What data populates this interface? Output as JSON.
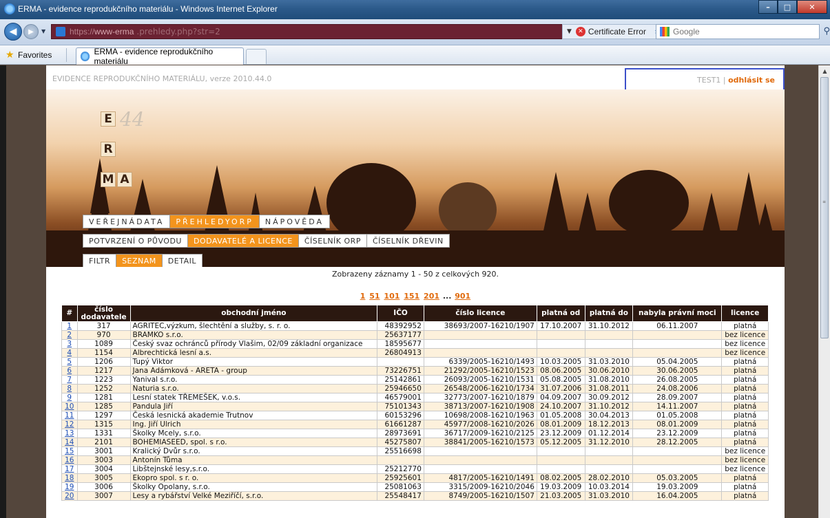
{
  "window": {
    "title": "ERMA - evidence reprodukčního materiálu - Windows Internet Explorer",
    "buttons": {
      "minimize": "–",
      "maximize": "□",
      "close": "✕"
    }
  },
  "browser": {
    "url_prefix": "https://",
    "url_host": "www-erma",
    "url_rest": ".prehledy.php?str=2",
    "cert_error": "Certificate Error",
    "search_placeholder": "Google",
    "favorites": "Favorites",
    "tab_title": "ERMA - evidence reprodukčního materiálu"
  },
  "header": {
    "app_version": "EVIDENCE REPRODUKČNÍHO MATERIÁLU, verze 2010.44.0",
    "user": "TEST1",
    "separator": "|",
    "logout": "odhlásit se"
  },
  "logo": {
    "letters": [
      "E",
      "R",
      "M",
      "A"
    ],
    "version": "44"
  },
  "menu_main": [
    {
      "label": "VEŘEJNÁDATA",
      "active": false
    },
    {
      "label": "PŘEHLEDYORP",
      "active": true
    },
    {
      "label": "NÁPOVĚDA",
      "active": false
    }
  ],
  "menu_sub": [
    {
      "label": "POTVRZENÍ O PŮVODU",
      "active": false
    },
    {
      "label": "DODAVATELÉ A LICENCE",
      "active": true
    },
    {
      "label": "ČÍSELNÍK ORP",
      "active": false
    },
    {
      "label": "ČÍSELNÍK DŘEVIN",
      "active": false
    }
  ],
  "menu_view": [
    {
      "label": "FILTR",
      "active": false
    },
    {
      "label": "SEZNAM",
      "active": true
    },
    {
      "label": "DETAIL",
      "active": false
    }
  ],
  "records_info": "Zobrazeny záznamy 1 - 50 z celkových 920.",
  "pager": {
    "pages": [
      "1",
      "51",
      "101",
      "151",
      "201"
    ],
    "ellipsis": "...",
    "last": "901"
  },
  "table": {
    "headers": [
      "#",
      "číslo dodavatele",
      "obchodní jméno",
      "IČO",
      "číslo licence",
      "platná od",
      "platná do",
      "nabyla právní moci",
      "licence"
    ],
    "rows": [
      [
        "1",
        "317",
        "AGRITEC,výzkum, šlechtění a služby, s. r. o.",
        "48392952",
        "38693/2007-16210/1907",
        "17.10.2007",
        "31.10.2012",
        "06.11.2007",
        "platná"
      ],
      [
        "2",
        "970",
        "BRAMKO s.r.o.",
        "25637177",
        "",
        "",
        "",
        "",
        "bez licence"
      ],
      [
        "3",
        "1089",
        "Český svaz ochránců přírody Vlašim, 02/09 základní organizace",
        "18595677",
        "",
        "",
        "",
        "",
        "bez licence"
      ],
      [
        "4",
        "1154",
        "Albrechtická lesní a.s.",
        "26804913",
        "",
        "",
        "",
        "",
        "bez licence"
      ],
      [
        "5",
        "1206",
        "Tupý Viktor",
        "",
        "6339/2005-16210/1493",
        "10.03.2005",
        "31.03.2010",
        "05.04.2005",
        "platná"
      ],
      [
        "6",
        "1217",
        "Jana Adámková - ARETA - group",
        "73226751",
        "21292/2005-16210/1523",
        "08.06.2005",
        "30.06.2010",
        "30.06.2005",
        "platná"
      ],
      [
        "7",
        "1223",
        "Yanival s.r.o.",
        "25142861",
        "26093/2005-16210/1531",
        "05.08.2005",
        "31.08.2010",
        "26.08.2005",
        "platná"
      ],
      [
        "8",
        "1252",
        "Naturia s.r.o.",
        "25946650",
        "26548/2006-16210/1734",
        "31.07.2006",
        "31.08.2011",
        "24.08.2006",
        "platná"
      ],
      [
        "9",
        "1281",
        "Lesní statek TŘEMEŠEK, v.o.s.",
        "46579001",
        "32773/2007-16210/1879",
        "04.09.2007",
        "30.09.2012",
        "28.09.2007",
        "platná"
      ],
      [
        "10",
        "1285",
        "Pandula Jiří",
        "75101343",
        "38713/2007-16210/1908",
        "24.10.2007",
        "31.10.2012",
        "14.11.2007",
        "platná"
      ],
      [
        "11",
        "1297",
        "Česká lesnická akademie Trutnov",
        "60153296",
        "10698/2008-16210/1963",
        "01.05.2008",
        "30.04.2013",
        "01.05.2008",
        "platná"
      ],
      [
        "12",
        "1315",
        "Ing. Jiří Ulrich",
        "61661287",
        "45977/2008-16210/2026",
        "08.01.2009",
        "18.12.2013",
        "08.01.2009",
        "platná"
      ],
      [
        "13",
        "1331",
        "Školky Mcely, s.r.o.",
        "28973691",
        "36717/2009-16210/2125",
        "23.12.2009",
        "01.12.2014",
        "23.12.2009",
        "platná"
      ],
      [
        "14",
        "2101",
        "BOHEMIASEED, spol. s r.o.",
        "45275807",
        "38841/2005-16210/1573",
        "05.12.2005",
        "31.12.2010",
        "28.12.2005",
        "platná"
      ],
      [
        "15",
        "3001",
        "Kralický Dvůr s.r.o.",
        "25516698",
        "",
        "",
        "",
        "",
        "bez licence"
      ],
      [
        "16",
        "3003",
        "Antonín Tůma",
        "",
        "",
        "",
        "",
        "",
        "bez licence"
      ],
      [
        "17",
        "3004",
        "Libštejnské lesy,s.r.o.",
        "25212770",
        "",
        "",
        "",
        "",
        "bez licence"
      ],
      [
        "18",
        "3005",
        "Ekopro spol. s r. o.",
        "25925601",
        "4817/2005-16210/1491",
        "08.02.2005",
        "28.02.2010",
        "05.03.2005",
        "platná"
      ],
      [
        "19",
        "3006",
        "Školky Opolany, s.r.o.",
        "25081063",
        "3315/2009-16210/2046",
        "19.03.2009",
        "10.03.2014",
        "19.03.2009",
        "platná"
      ],
      [
        "20",
        "3007",
        "Lesy a rybářství Velké Meziříčí, s.r.o.",
        "25548417",
        "8749/2005-16210/1507",
        "21.03.2005",
        "31.03.2010",
        "16.04.2005",
        "platná"
      ]
    ]
  }
}
